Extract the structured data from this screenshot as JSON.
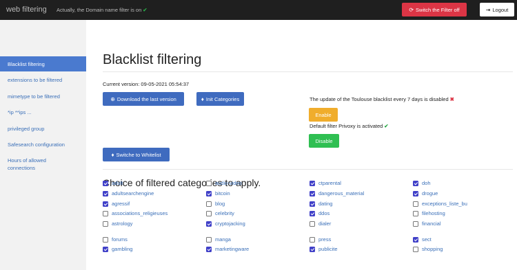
{
  "topbar": {
    "brand": "web filtering",
    "status_text": "Actually, the Domain name filter is on",
    "status_icon": "check-icon",
    "switch_label": "Switch the Filter off",
    "logout_label": "Logout"
  },
  "sidebar": {
    "items": [
      {
        "label": "Blacklist filtering",
        "active": true
      },
      {
        "label": "extensions to be filtered"
      },
      {
        "label": "mimetype to be filtered"
      },
      {
        "label": "*ip **ips ..."
      },
      {
        "label": "privileged group"
      },
      {
        "label": "Safesearch configuration"
      },
      {
        "label": "Hours of allowed"
      },
      {
        "label": "connections"
      }
    ]
  },
  "main": {
    "title": "Blacklist filtering",
    "version_text": "Current version: 09-05-2021 05:54:37",
    "download_label": "Download the last version",
    "init_label": "Init Categories",
    "whitelist_label": "Switche to Whitelist",
    "toulouse_status": "The update of the Toulouse blacklist every 7 days is disabled",
    "enable_label": "Enable",
    "privoxy_status": "Default filter Privoxy is activated",
    "disable_label": "Disable",
    "choice_title": "Choice of filtered categories to apply."
  },
  "colors": {
    "accent": "#3f6bbf",
    "danger": "#dc3545",
    "warning": "#f0ad2c",
    "success": "#2fbf52"
  },
  "categories": [
    {
      "label": "adult",
      "checked": true
    },
    {
      "label": "audio-video",
      "checked": false
    },
    {
      "label": "ctparental",
      "checked": true
    },
    {
      "label": "doh",
      "checked": true
    },
    {
      "label": "adultsearchengine",
      "checked": true
    },
    {
      "label": "bitcoin",
      "checked": true
    },
    {
      "label": "dangerous_material",
      "checked": true
    },
    {
      "label": "drogue",
      "checked": true
    },
    {
      "label": "agressif",
      "checked": true
    },
    {
      "label": "blog",
      "checked": false
    },
    {
      "label": "dating",
      "checked": true
    },
    {
      "label": "exceptions_liste_bu",
      "checked": false
    },
    {
      "label": "associations_religieuses",
      "checked": false
    },
    {
      "label": "celebrity",
      "checked": false
    },
    {
      "label": "ddos",
      "checked": true
    },
    {
      "label": "filehosting",
      "checked": false
    },
    {
      "label": "astrology",
      "checked": false
    },
    {
      "label": "cryptojacking",
      "checked": true
    },
    {
      "label": "dialer",
      "checked": false
    },
    {
      "label": "financial",
      "checked": false
    },
    {
      "label": "forums",
      "checked": false
    },
    {
      "label": "manga",
      "checked": false
    },
    {
      "label": "press",
      "checked": false
    },
    {
      "label": "sect",
      "checked": true
    },
    {
      "label": "gambling",
      "checked": true
    },
    {
      "label": "marketingware",
      "checked": true
    },
    {
      "label": "publicite",
      "checked": true
    },
    {
      "label": "shopping",
      "checked": false
    }
  ]
}
